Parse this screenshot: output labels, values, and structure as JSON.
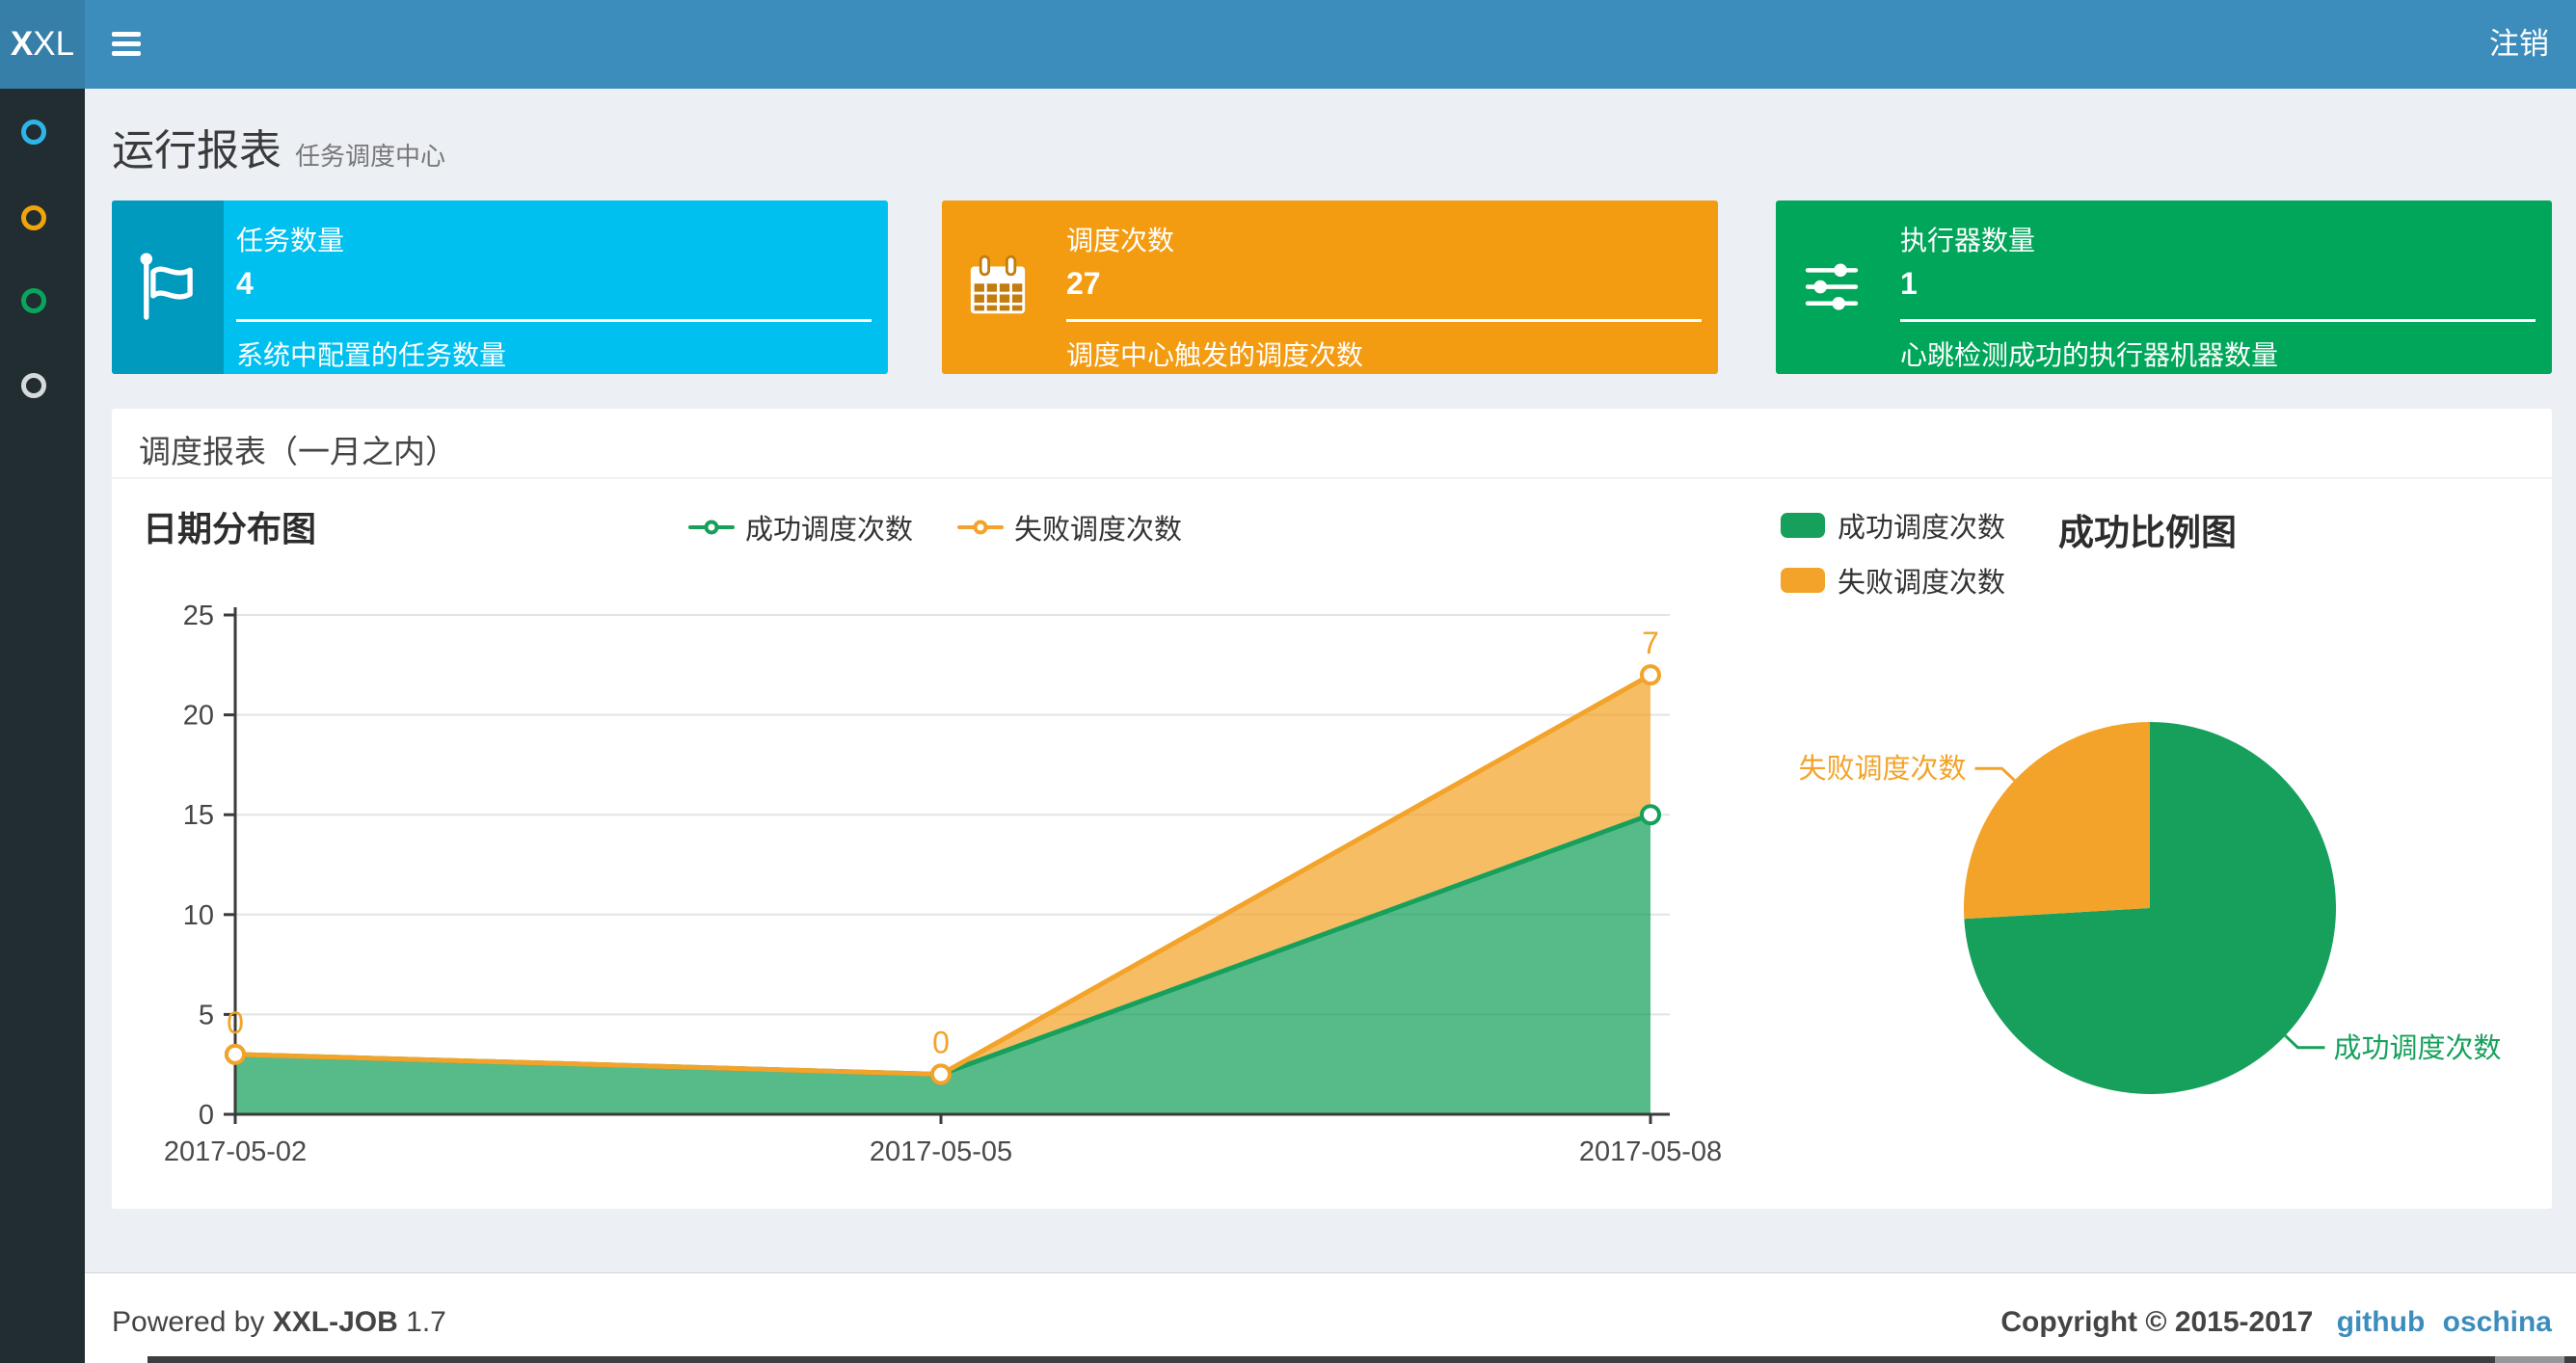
{
  "navbar": {
    "logo_bold": "X",
    "logo_rest": "XL",
    "logout_label": "注销"
  },
  "sidebar": {
    "items": [
      {
        "name": "menu-item-1",
        "color": "#2eb5e8"
      },
      {
        "name": "menu-item-2",
        "color": "#f0a30a"
      },
      {
        "name": "menu-item-3",
        "color": "#0aa55c"
      },
      {
        "name": "menu-item-4",
        "color": "#d6dade"
      }
    ]
  },
  "page_header": {
    "title": "运行报表",
    "subtitle": "任务调度中心"
  },
  "info_boxes": [
    {
      "label": "任务数量",
      "value": "4",
      "description": "系统中配置的任务数量",
      "color": "#00c0ef",
      "icon_bg": "#009abf",
      "icon": "flag-icon"
    },
    {
      "label": "调度次数",
      "value": "27",
      "description": "调度中心触发的调度次数",
      "color": "#f39c12",
      "icon_bg": "#c27d0e",
      "icon": "calendar-icon"
    },
    {
      "label": "执行器数量",
      "value": "1",
      "description": "心跳检测成功的执行器机器数量",
      "color": "#00a65a",
      "icon_bg": "#008548",
      "icon": "sliders-icon"
    }
  ],
  "panel": {
    "title": "调度报表（一月之内）"
  },
  "chart_data": [
    {
      "type": "area",
      "title": "日期分布图",
      "x": [
        "2017-05-02",
        "2017-05-05",
        "2017-05-08"
      ],
      "stacked": true,
      "series": [
        {
          "name": "成功调度次数",
          "color": "#16a05c",
          "values": [
            3,
            2,
            15
          ]
        },
        {
          "name": "失败调度次数",
          "color": "#f3a32a",
          "values": [
            0,
            0,
            7
          ],
          "labels": [
            "0",
            "0",
            "7"
          ]
        }
      ],
      "ylim": [
        0,
        25
      ],
      "yticks": [
        0,
        5,
        10,
        15,
        20,
        25
      ],
      "grid": true,
      "legend_position": "top-center"
    },
    {
      "type": "pie",
      "title": "成功比例图",
      "slices": [
        {
          "name": "成功调度次数",
          "value": 20,
          "color": "#16a05c"
        },
        {
          "name": "失败调度次数",
          "value": 7,
          "color": "#f3a32a"
        }
      ],
      "total": 27,
      "legend_position": "top-left"
    }
  ],
  "footer": {
    "powered_prefix": "Powered by",
    "product": "XXL-JOB",
    "version": "1.7",
    "copyright": "Copyright © 2015-2017",
    "link1": "github",
    "link2": "oschina"
  }
}
